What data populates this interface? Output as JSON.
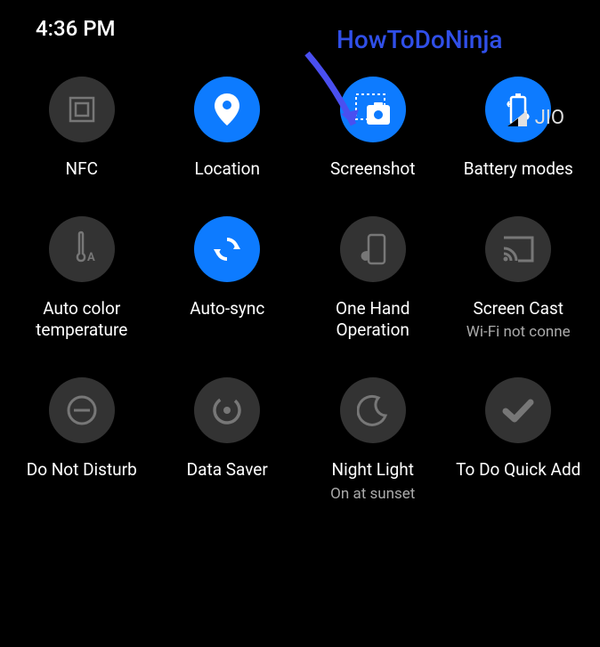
{
  "status": {
    "time": "4:36 PM",
    "carrier": "JIO"
  },
  "annotation": {
    "text": "HowToDoNinja"
  },
  "tiles": {
    "nfc": {
      "label": "NFC",
      "active": false
    },
    "location": {
      "label": "Location",
      "active": true
    },
    "screenshot": {
      "label": "Screenshot",
      "active": true
    },
    "battery": {
      "label": "Battery modes",
      "active": true
    },
    "autocolor": {
      "label": "Auto color temperature",
      "active": false
    },
    "autosync": {
      "label": "Auto-sync",
      "active": true
    },
    "onehand": {
      "label": "One Hand Operation",
      "active": false
    },
    "screencast": {
      "label": "Screen Cast",
      "sublabel": "Wi-Fi not conne",
      "active": false
    },
    "dnd": {
      "label": "Do Not Disturb",
      "active": false
    },
    "datasaver": {
      "label": "Data Saver",
      "active": false
    },
    "nightlight": {
      "label": "Night Light",
      "sublabel": "On at sunset",
      "active": false
    },
    "todo": {
      "label": "To Do Quick Add",
      "active": false
    }
  }
}
